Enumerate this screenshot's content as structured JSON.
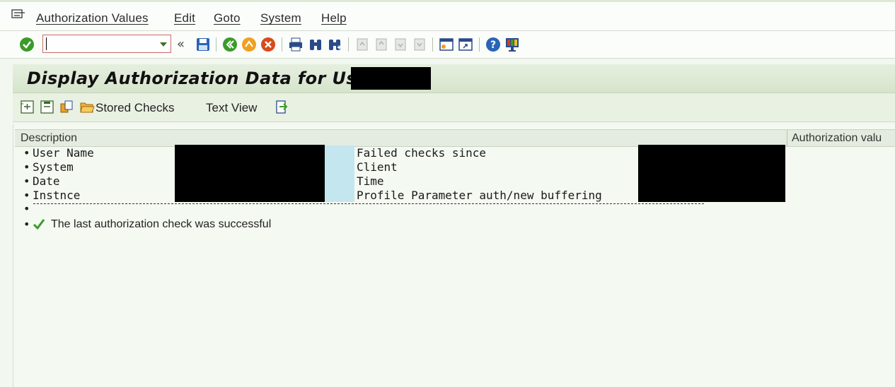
{
  "menubar": {
    "items": [
      "Authorization Values",
      "Edit",
      "Goto",
      "System",
      "Help"
    ]
  },
  "systoolbar": {
    "command_field_value": "",
    "collapse_label": "«"
  },
  "title": {
    "text": "Display Authorization Data for User"
  },
  "app_toolbar": {
    "stored_checks_label": "Stored Checks",
    "text_view_label": "Text View"
  },
  "table": {
    "col_description": "Description",
    "col_authorization_value": "Authorization valu"
  },
  "info": {
    "left_labels": [
      "User Name",
      "System",
      "Date",
      "Instnce"
    ],
    "right_labels": [
      "Failed checks since",
      "Client",
      "Time",
      "Profile Parameter auth/new buffering"
    ],
    "status_message": "The last authorization check was successful"
  },
  "colors": {
    "accent_green": "#3c9a2a",
    "highlight_cyan": "#c4e6ee",
    "redaction": "#000000"
  }
}
